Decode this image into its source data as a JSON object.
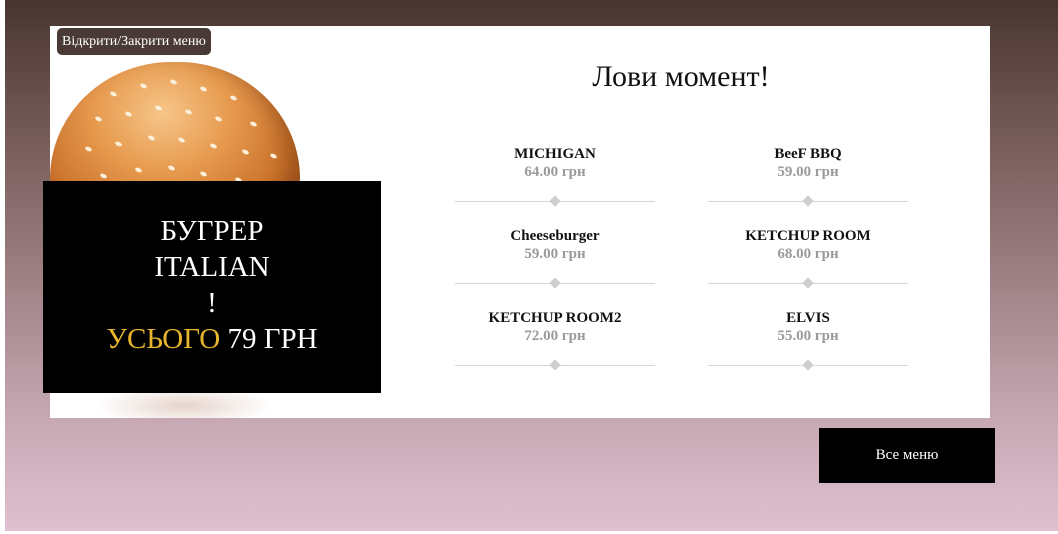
{
  "menu_toggle_label": "Відкрити/Закрити меню",
  "promo": {
    "line1": "БУГРЕР",
    "line2": "ITALIAN",
    "line3": "!",
    "total_word": "УСЬОГО",
    "total_price": "79 ГРН"
  },
  "headline": "Лови момент!",
  "items": [
    {
      "name": "MICHIGAN",
      "price": "64.00 грн"
    },
    {
      "name": "BeeF BBQ",
      "price": "59.00 грн"
    },
    {
      "name": "Cheeseburger",
      "price": "59.00 грн"
    },
    {
      "name": "KETCHUP ROOM",
      "price": "68.00 грн"
    },
    {
      "name": "KETCHUP ROOM2",
      "price": "72.00 грн"
    },
    {
      "name": "ELVIS",
      "price": "55.00 грн"
    }
  ],
  "all_menu_label": "Все меню",
  "colors": {
    "accent_gold": "#e8b62c",
    "promo_bg": "#000000",
    "price_grey": "#9a9a9a"
  }
}
